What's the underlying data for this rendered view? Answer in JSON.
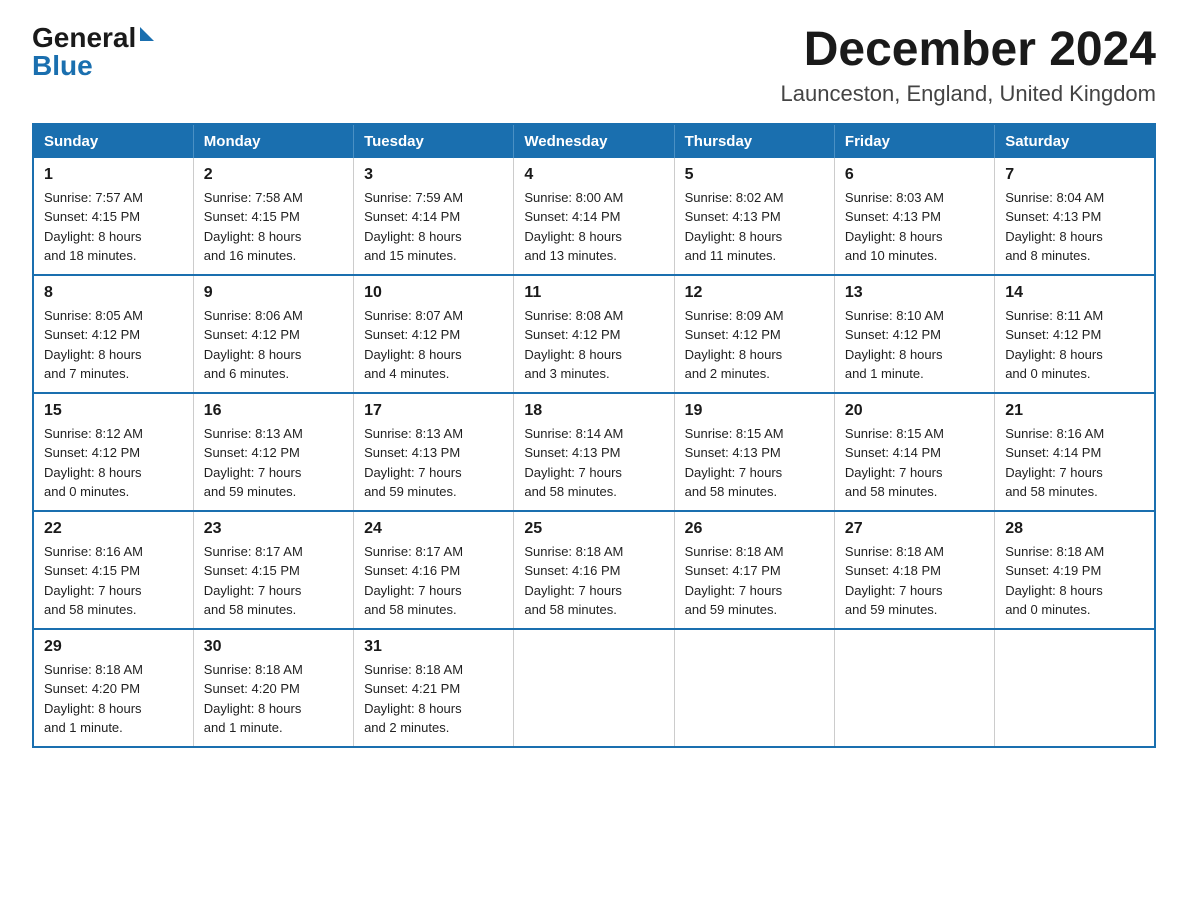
{
  "logo": {
    "general": "General",
    "blue": "Blue",
    "triangle": "▶"
  },
  "title": {
    "month_year": "December 2024",
    "location": "Launceston, England, United Kingdom"
  },
  "weekdays": [
    "Sunday",
    "Monday",
    "Tuesday",
    "Wednesday",
    "Thursday",
    "Friday",
    "Saturday"
  ],
  "weeks": [
    [
      {
        "day": "1",
        "sunrise": "Sunrise: 7:57 AM",
        "sunset": "Sunset: 4:15 PM",
        "daylight": "Daylight: 8 hours",
        "daylight2": "and 18 minutes."
      },
      {
        "day": "2",
        "sunrise": "Sunrise: 7:58 AM",
        "sunset": "Sunset: 4:15 PM",
        "daylight": "Daylight: 8 hours",
        "daylight2": "and 16 minutes."
      },
      {
        "day": "3",
        "sunrise": "Sunrise: 7:59 AM",
        "sunset": "Sunset: 4:14 PM",
        "daylight": "Daylight: 8 hours",
        "daylight2": "and 15 minutes."
      },
      {
        "day": "4",
        "sunrise": "Sunrise: 8:00 AM",
        "sunset": "Sunset: 4:14 PM",
        "daylight": "Daylight: 8 hours",
        "daylight2": "and 13 minutes."
      },
      {
        "day": "5",
        "sunrise": "Sunrise: 8:02 AM",
        "sunset": "Sunset: 4:13 PM",
        "daylight": "Daylight: 8 hours",
        "daylight2": "and 11 minutes."
      },
      {
        "day": "6",
        "sunrise": "Sunrise: 8:03 AM",
        "sunset": "Sunset: 4:13 PM",
        "daylight": "Daylight: 8 hours",
        "daylight2": "and 10 minutes."
      },
      {
        "day": "7",
        "sunrise": "Sunrise: 8:04 AM",
        "sunset": "Sunset: 4:13 PM",
        "daylight": "Daylight: 8 hours",
        "daylight2": "and 8 minutes."
      }
    ],
    [
      {
        "day": "8",
        "sunrise": "Sunrise: 8:05 AM",
        "sunset": "Sunset: 4:12 PM",
        "daylight": "Daylight: 8 hours",
        "daylight2": "and 7 minutes."
      },
      {
        "day": "9",
        "sunrise": "Sunrise: 8:06 AM",
        "sunset": "Sunset: 4:12 PM",
        "daylight": "Daylight: 8 hours",
        "daylight2": "and 6 minutes."
      },
      {
        "day": "10",
        "sunrise": "Sunrise: 8:07 AM",
        "sunset": "Sunset: 4:12 PM",
        "daylight": "Daylight: 8 hours",
        "daylight2": "and 4 minutes."
      },
      {
        "day": "11",
        "sunrise": "Sunrise: 8:08 AM",
        "sunset": "Sunset: 4:12 PM",
        "daylight": "Daylight: 8 hours",
        "daylight2": "and 3 minutes."
      },
      {
        "day": "12",
        "sunrise": "Sunrise: 8:09 AM",
        "sunset": "Sunset: 4:12 PM",
        "daylight": "Daylight: 8 hours",
        "daylight2": "and 2 minutes."
      },
      {
        "day": "13",
        "sunrise": "Sunrise: 8:10 AM",
        "sunset": "Sunset: 4:12 PM",
        "daylight": "Daylight: 8 hours",
        "daylight2": "and 1 minute."
      },
      {
        "day": "14",
        "sunrise": "Sunrise: 8:11 AM",
        "sunset": "Sunset: 4:12 PM",
        "daylight": "Daylight: 8 hours",
        "daylight2": "and 0 minutes."
      }
    ],
    [
      {
        "day": "15",
        "sunrise": "Sunrise: 8:12 AM",
        "sunset": "Sunset: 4:12 PM",
        "daylight": "Daylight: 8 hours",
        "daylight2": "and 0 minutes."
      },
      {
        "day": "16",
        "sunrise": "Sunrise: 8:13 AM",
        "sunset": "Sunset: 4:12 PM",
        "daylight": "Daylight: 7 hours",
        "daylight2": "and 59 minutes."
      },
      {
        "day": "17",
        "sunrise": "Sunrise: 8:13 AM",
        "sunset": "Sunset: 4:13 PM",
        "daylight": "Daylight: 7 hours",
        "daylight2": "and 59 minutes."
      },
      {
        "day": "18",
        "sunrise": "Sunrise: 8:14 AM",
        "sunset": "Sunset: 4:13 PM",
        "daylight": "Daylight: 7 hours",
        "daylight2": "and 58 minutes."
      },
      {
        "day": "19",
        "sunrise": "Sunrise: 8:15 AM",
        "sunset": "Sunset: 4:13 PM",
        "daylight": "Daylight: 7 hours",
        "daylight2": "and 58 minutes."
      },
      {
        "day": "20",
        "sunrise": "Sunrise: 8:15 AM",
        "sunset": "Sunset: 4:14 PM",
        "daylight": "Daylight: 7 hours",
        "daylight2": "and 58 minutes."
      },
      {
        "day": "21",
        "sunrise": "Sunrise: 8:16 AM",
        "sunset": "Sunset: 4:14 PM",
        "daylight": "Daylight: 7 hours",
        "daylight2": "and 58 minutes."
      }
    ],
    [
      {
        "day": "22",
        "sunrise": "Sunrise: 8:16 AM",
        "sunset": "Sunset: 4:15 PM",
        "daylight": "Daylight: 7 hours",
        "daylight2": "and 58 minutes."
      },
      {
        "day": "23",
        "sunrise": "Sunrise: 8:17 AM",
        "sunset": "Sunset: 4:15 PM",
        "daylight": "Daylight: 7 hours",
        "daylight2": "and 58 minutes."
      },
      {
        "day": "24",
        "sunrise": "Sunrise: 8:17 AM",
        "sunset": "Sunset: 4:16 PM",
        "daylight": "Daylight: 7 hours",
        "daylight2": "and 58 minutes."
      },
      {
        "day": "25",
        "sunrise": "Sunrise: 8:18 AM",
        "sunset": "Sunset: 4:16 PM",
        "daylight": "Daylight: 7 hours",
        "daylight2": "and 58 minutes."
      },
      {
        "day": "26",
        "sunrise": "Sunrise: 8:18 AM",
        "sunset": "Sunset: 4:17 PM",
        "daylight": "Daylight: 7 hours",
        "daylight2": "and 59 minutes."
      },
      {
        "day": "27",
        "sunrise": "Sunrise: 8:18 AM",
        "sunset": "Sunset: 4:18 PM",
        "daylight": "Daylight: 7 hours",
        "daylight2": "and 59 minutes."
      },
      {
        "day": "28",
        "sunrise": "Sunrise: 8:18 AM",
        "sunset": "Sunset: 4:19 PM",
        "daylight": "Daylight: 8 hours",
        "daylight2": "and 0 minutes."
      }
    ],
    [
      {
        "day": "29",
        "sunrise": "Sunrise: 8:18 AM",
        "sunset": "Sunset: 4:20 PM",
        "daylight": "Daylight: 8 hours",
        "daylight2": "and 1 minute."
      },
      {
        "day": "30",
        "sunrise": "Sunrise: 8:18 AM",
        "sunset": "Sunset: 4:20 PM",
        "daylight": "Daylight: 8 hours",
        "daylight2": "and 1 minute."
      },
      {
        "day": "31",
        "sunrise": "Sunrise: 8:18 AM",
        "sunset": "Sunset: 4:21 PM",
        "daylight": "Daylight: 8 hours",
        "daylight2": "and 2 minutes."
      },
      null,
      null,
      null,
      null
    ]
  ]
}
